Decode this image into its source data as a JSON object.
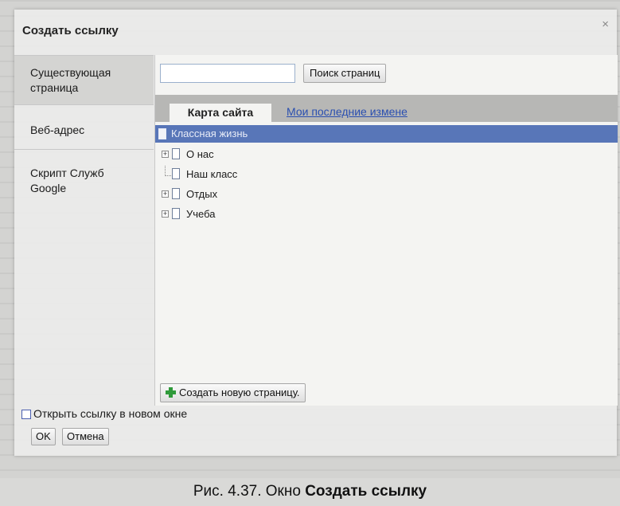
{
  "dialog": {
    "title": "Создать ссылку",
    "close_label": "×"
  },
  "nav": {
    "items": [
      {
        "label": "Существующая страница"
      },
      {
        "label": "Веб-адрес"
      },
      {
        "label": "Скрипт Служб Google"
      }
    ]
  },
  "search": {
    "value": "",
    "button_label": "Поиск страниц"
  },
  "tabs": {
    "active_label": "Карта сайта",
    "other_label": "Мои последние измене"
  },
  "tree": {
    "root": "Классная жизнь",
    "items": [
      "О нас",
      "Наш класс",
      "Отдых",
      "Учеба"
    ]
  },
  "create_page_button": "Создать новую страницу.",
  "new_window_label": "Открыть ссылку в новом окне",
  "ok_label": "OK",
  "cancel_label": "Отмена",
  "caption": {
    "prefix": "Рис. 4.37. Окно ",
    "bold": "Создать ссылку"
  },
  "colors": {
    "tree_selected": "#5876b8",
    "link": "#2a4fb0",
    "plus_icon": "#2f9a3a"
  }
}
